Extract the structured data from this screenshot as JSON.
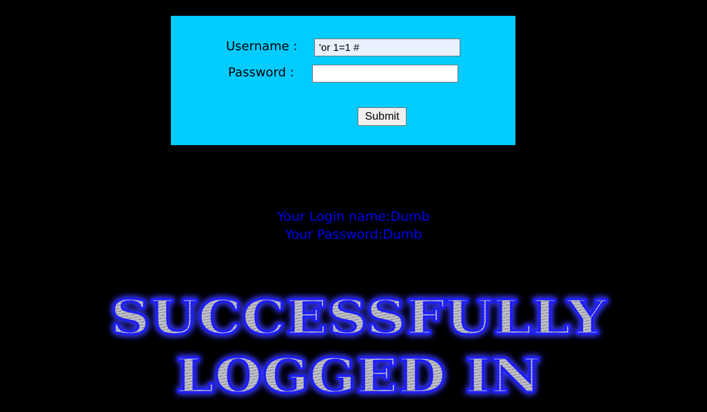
{
  "form": {
    "username_label": "Username :",
    "password_label": "Password :",
    "username_value": "'or 1=1 #",
    "password_value": "",
    "submit_label": "Submit",
    "panel_color": "#00ccff"
  },
  "result": {
    "login_name_line": "Your Login name:Dumb",
    "password_line": "Your Password:Dumb",
    "text_color": "#0000ee"
  },
  "banner": {
    "line1": "SUCCESSFULLY",
    "line2": "LOGGED IN",
    "glow_color": "#2a2aff",
    "fill_color": "#a8a8b0"
  }
}
